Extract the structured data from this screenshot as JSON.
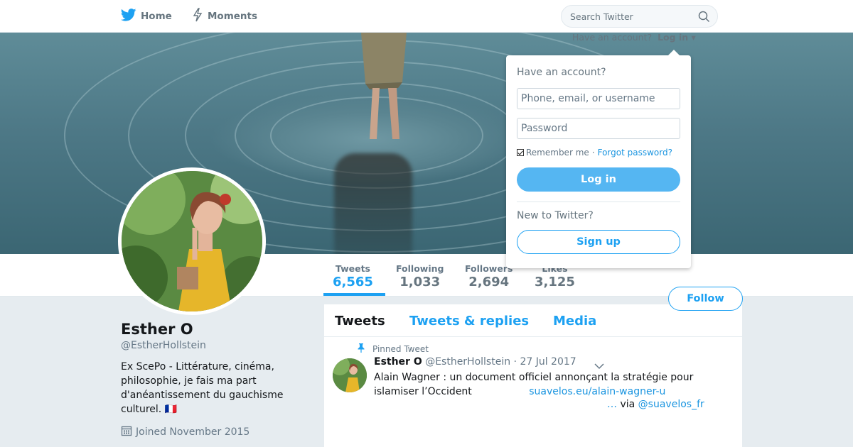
{
  "nav": {
    "home_label": "Home",
    "moments_label": "Moments",
    "home_icon": "twitter-bird-icon",
    "moments_icon": "lightning-icon"
  },
  "search": {
    "placeholder": "Search Twitter",
    "icon": "search-icon"
  },
  "login_hint": {
    "question": "Have an account?",
    "login_label": "Log in"
  },
  "login_dropdown": {
    "title": "Have an account?",
    "username_placeholder": "Phone, email, or username",
    "password_placeholder": "Password",
    "remember_label": "Remember me",
    "separator": "·",
    "forgot_label": "Forgot password?",
    "login_button": "Log in",
    "new_label": "New to Twitter?",
    "signup_button": "Sign up"
  },
  "stats": [
    {
      "label": "Tweets",
      "value": "6,565"
    },
    {
      "label": "Following",
      "value": "1,033"
    },
    {
      "label": "Followers",
      "value": "2,694"
    },
    {
      "label": "Likes",
      "value": "3,125"
    }
  ],
  "follow_button": "Follow",
  "profile": {
    "name": "Esther O",
    "handle": "@EstherHollstein",
    "bio": "Ex ScePo - Littérature, cinéma, philosophie, je fais ma part d'anéantissement du gauchisme culturel. 🇫🇷",
    "joined": "Joined November 2015"
  },
  "tabs": [
    "Tweets",
    "Tweets & replies",
    "Media"
  ],
  "pinned_tweet": {
    "pinned_label": "Pinned Tweet",
    "name": "Esther O",
    "handle": "@EstherHollstein",
    "date": "· 27 Jul 2017",
    "text": "Alain Wagner : un document officiel annonçant la stratégie pour islamiser l’Occident",
    "link": "suavelos.eu/alain-wagner-u",
    "ellipsis": "…",
    "via": "via",
    "via_handle": "@suavelos_fr"
  },
  "colors": {
    "accent": "#1da1f2",
    "background": "#e6ecf0"
  }
}
